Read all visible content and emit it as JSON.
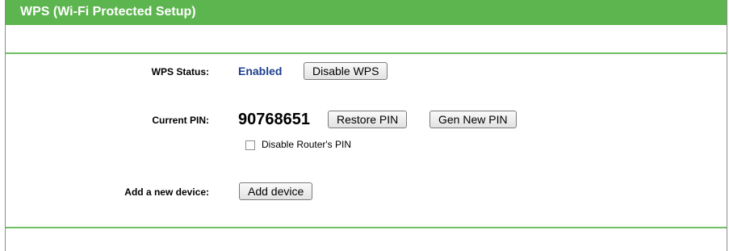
{
  "header": {
    "title": "WPS (Wi-Fi Protected Setup)"
  },
  "wps_status": {
    "label": "WPS Status:",
    "value": "Enabled",
    "button": "Disable WPS"
  },
  "current_pin": {
    "label": "Current PIN:",
    "value": "90768651",
    "restore_button": "Restore PIN",
    "gen_button": "Gen New PIN",
    "disable_checkbox_label": "Disable Router's PIN",
    "disable_checked": false
  },
  "add_device": {
    "label": "Add a new device:",
    "button": "Add device"
  }
}
